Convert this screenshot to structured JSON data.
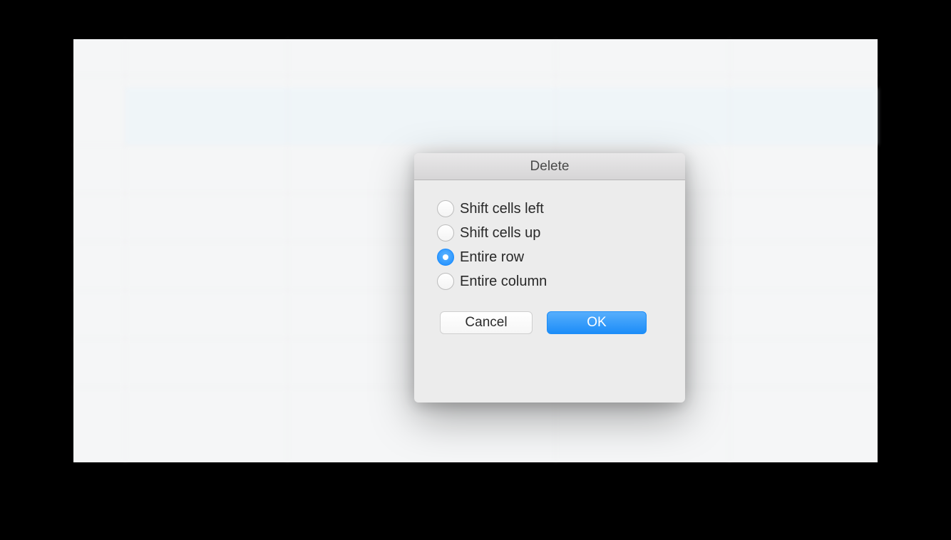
{
  "dialog": {
    "title": "Delete",
    "options": [
      {
        "label": "Shift cells left",
        "selected": false
      },
      {
        "label": "Shift cells up",
        "selected": false
      },
      {
        "label": "Entire row",
        "selected": true
      },
      {
        "label": "Entire column",
        "selected": false
      }
    ],
    "buttons": {
      "cancel": "Cancel",
      "ok": "OK"
    }
  }
}
